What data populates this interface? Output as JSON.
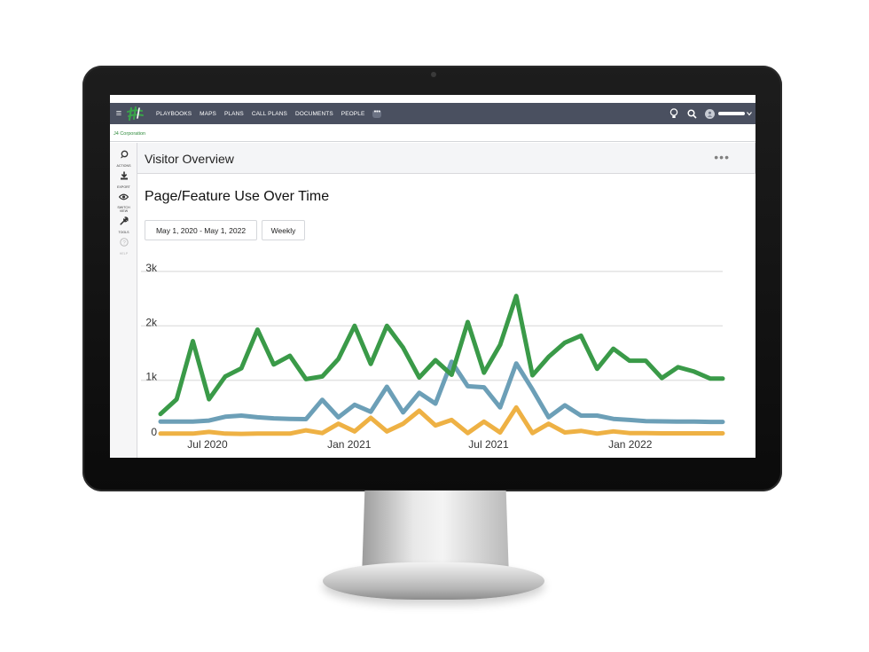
{
  "app": {
    "menu_icon": "hamburger-menu-icon",
    "logo": "j4-logo-icon",
    "nav": [
      "PLAYBOOKS",
      "MAPS",
      "PLANS",
      "CALL PLANS",
      "DOCUMENTS",
      "PEOPLE"
    ],
    "nav_more": "•••",
    "right_icons": [
      "lightbulb-icon",
      "search-icon",
      "user-avatar-icon",
      "chevron-down-icon"
    ]
  },
  "org": {
    "name": "J4 Corporation"
  },
  "sidebar": {
    "items": [
      {
        "label": "ACTIONS",
        "icon": "actions-icon"
      },
      {
        "label": "EXPORT",
        "icon": "download-icon"
      },
      {
        "label": "SWITCH VIEW",
        "icon": "eye-icon"
      },
      {
        "label": "TOOLS",
        "icon": "wrench-icon"
      },
      {
        "label": "HELP",
        "icon": "help-icon"
      }
    ]
  },
  "panel": {
    "title": "Visitor Overview",
    "menu": "•••"
  },
  "chart_title": "Page/Feature Use Over Time",
  "filters": {
    "date_range": "May 1, 2020 - May 1, 2022",
    "period": "Weekly"
  },
  "chart_data": {
    "type": "line",
    "title": "Page/Feature Use Over Time",
    "xlabel": "",
    "ylabel": "",
    "x_ticks": [
      "Jul 2020",
      "Jan 2021",
      "Jul 2021",
      "Jan 2022"
    ],
    "y_ticks": [
      "0",
      "1k",
      "2k",
      "3k"
    ],
    "ylim": [
      0,
      3000
    ],
    "grid": true,
    "legend": "none",
    "x": [
      "2020-05-01",
      "2020-05-22",
      "2020-06-12",
      "2020-07-03",
      "2020-07-24",
      "2020-08-14",
      "2020-09-04",
      "2020-09-25",
      "2020-10-16",
      "2020-11-06",
      "2020-11-27",
      "2020-12-18",
      "2021-01-08",
      "2021-01-29",
      "2021-02-19",
      "2021-03-12",
      "2021-04-02",
      "2021-04-23",
      "2021-05-14",
      "2021-06-04",
      "2021-06-25",
      "2021-07-16",
      "2021-08-06",
      "2021-08-27",
      "2021-09-17",
      "2021-10-08",
      "2021-10-29",
      "2021-11-19",
      "2021-12-10",
      "2021-12-31",
      "2022-01-21",
      "2022-02-11",
      "2022-03-04",
      "2022-03-25",
      "2022-04-15",
      "2022-05-01"
    ],
    "series": [
      {
        "color": "#3a9a48",
        "values": [
          380,
          650,
          1720,
          650,
          1070,
          1220,
          1930,
          1290,
          1450,
          1020,
          1070,
          1390,
          2000,
          1300,
          2000,
          1600,
          1050,
          1370,
          1100,
          2070,
          1140,
          1650,
          2550,
          1090,
          1430,
          1690,
          1820,
          1210,
          1580,
          1360,
          1360,
          1040,
          1240,
          1160,
          1030,
          1030
        ]
      },
      {
        "color": "#6c9fb7",
        "values": [
          240,
          240,
          240,
          260,
          330,
          350,
          320,
          300,
          290,
          285,
          640,
          320,
          550,
          420,
          880,
          410,
          770,
          570,
          1340,
          890,
          870,
          500,
          1310,
          830,
          320,
          540,
          350,
          350,
          290,
          270,
          250,
          245,
          240,
          240,
          235,
          235
        ]
      },
      {
        "color": "#eeb144",
        "values": [
          20,
          20,
          20,
          50,
          20,
          15,
          20,
          20,
          20,
          80,
          30,
          200,
          60,
          310,
          60,
          200,
          440,
          170,
          270,
          30,
          240,
          40,
          500,
          30,
          200,
          40,
          70,
          20,
          60,
          30,
          30,
          25,
          25,
          25,
          25,
          25
        ]
      }
    ]
  }
}
